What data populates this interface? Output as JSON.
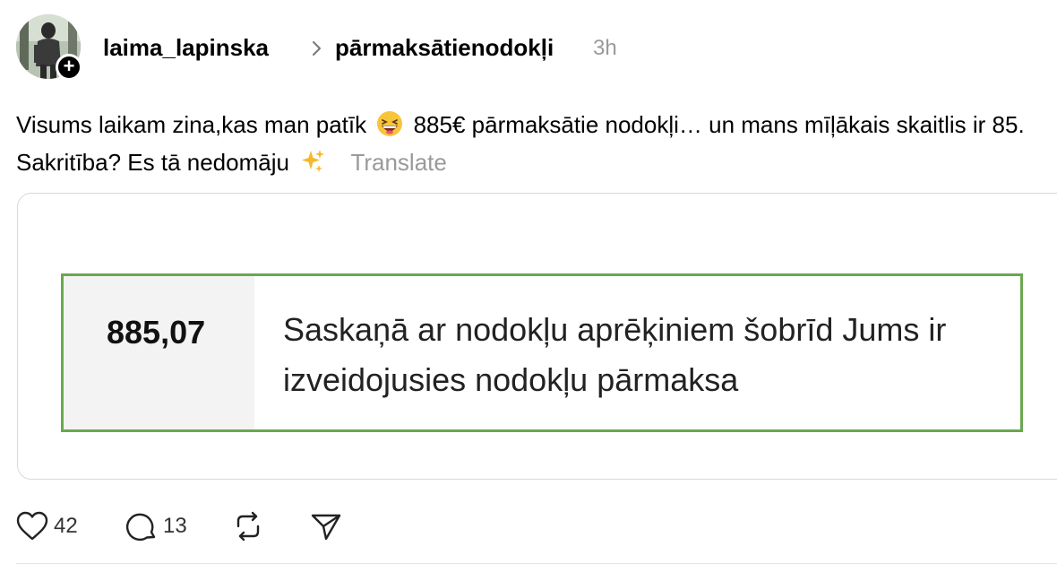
{
  "post": {
    "username": "laima_lapinska",
    "topic": "pārmaksātienodokļi",
    "time": "3h",
    "text_part1": "Visums laikam zina,kas man patīk",
    "text_part2": "885€ pārmaksātie nodokļi… un mans mīļākais skaitlis ir 85. Sakritība? Es tā nedomāju",
    "translate_label": "Translate",
    "emoji1": "grinning-squinting-face",
    "emoji2": "sparkles"
  },
  "media": {
    "amount": "885,07",
    "message": "Saskaņā ar nodokļu aprēķiniem šobrīd Jums ir izveidojusies nodokļu pārmaksa",
    "border_color": "#6aa84f"
  },
  "actions": {
    "likes": "42",
    "comments": "13"
  }
}
